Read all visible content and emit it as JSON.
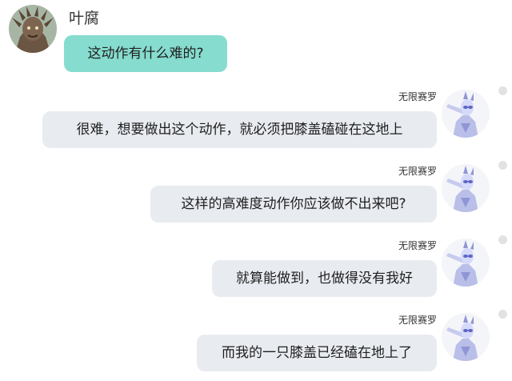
{
  "contact": {
    "name": "叶腐",
    "avatar_icon": "creature-avatar-icon"
  },
  "reply_author": {
    "name": "无限赛罗",
    "avatar_icon": "hero-avatar-icon"
  },
  "messages": [
    {
      "sender": "叶腐",
      "text": "这动作有什么难的?"
    },
    {
      "sender": "无限赛罗",
      "text": "很难，想要做出这个动作，就必须把膝盖磕碰在这地上"
    },
    {
      "sender": "无限赛罗",
      "text": "这样的高难度动作你应该做不出来吧?"
    },
    {
      "sender": "无限赛罗",
      "text": "就算能做到，也做得没有我好"
    },
    {
      "sender": "无限赛罗",
      "text": "而我的一只膝盖已经磕在地上了"
    }
  ],
  "colors": {
    "left_bubble": "#86dcce",
    "right_bubble": "#e8ebf0",
    "background": "#ffffff"
  }
}
